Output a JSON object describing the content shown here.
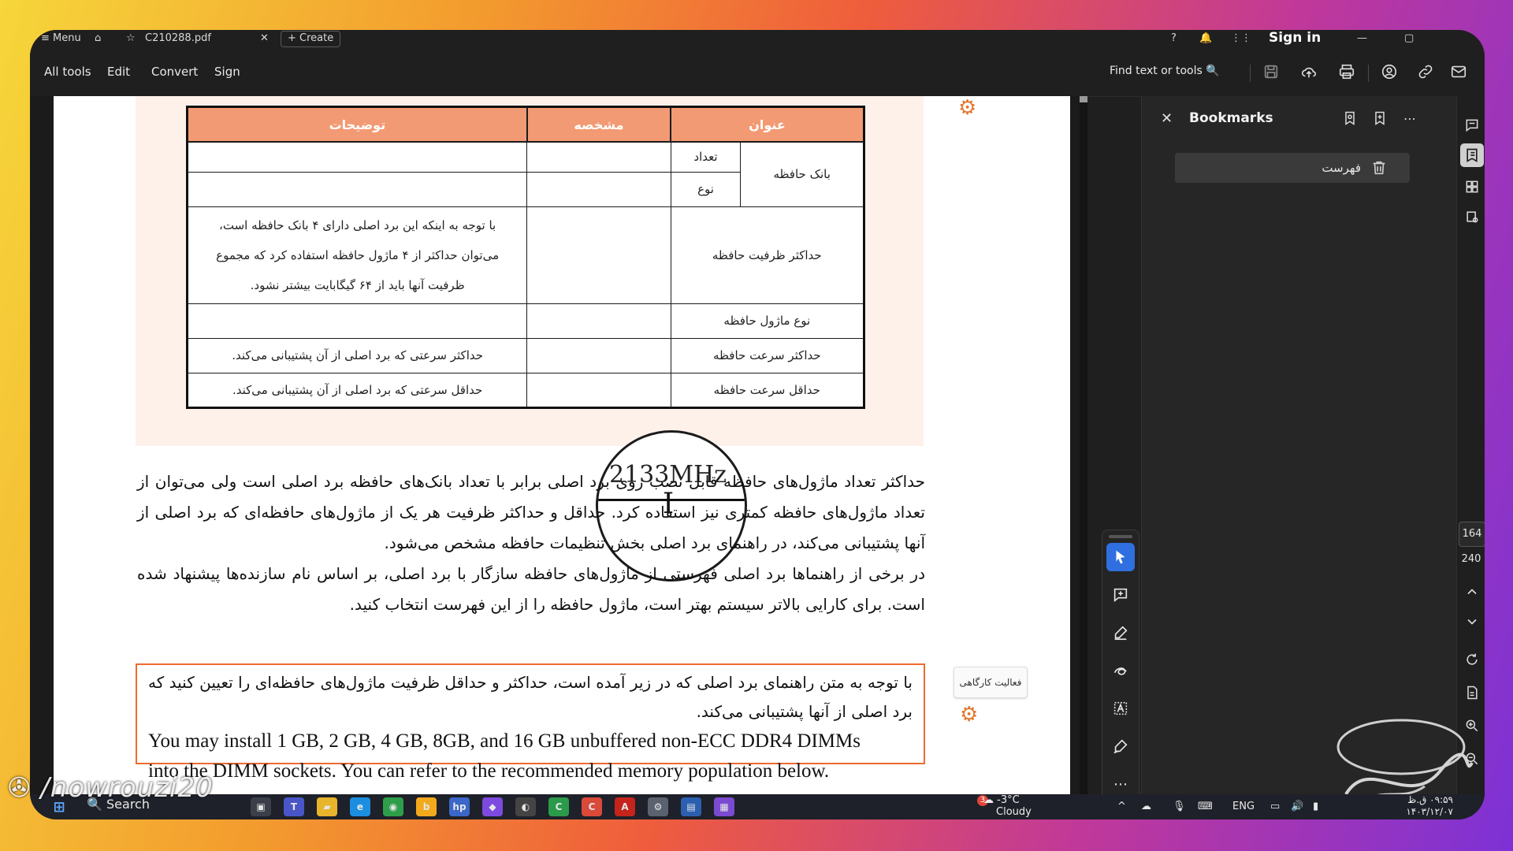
{
  "titlebar": {
    "menu_label": "Menu",
    "tab_name": "C210288.pdf",
    "create_label": "Create",
    "sign_in": "Sign in"
  },
  "toolbar": {
    "all_tools": "All tools",
    "edit": "Edit",
    "convert": "Convert",
    "sign": "Sign",
    "find_placeholder": "Find text or tools"
  },
  "table": {
    "headers": [
      "عنوان",
      "مشخصه",
      "توضیحات"
    ],
    "rows": {
      "memory_bank": "بانک حافظه",
      "count": "تعداد",
      "type": "نوع",
      "max_capacity": "حداکثر ظرفیت حافظه",
      "max_capacity_desc_1": "با توجه به اینکه این برد اصلی دارای ۴ بانک حافظه است،",
      "max_capacity_desc_2": "می‌توان حداکثر از ۴ ماژول حافظه استفاده کرد که مجموع",
      "max_capacity_desc_3": "ظرفیت آنها باید از ۶۴ گیگابایت بیشتر نشود.",
      "module_type": "نوع ماژول حافظه",
      "max_speed": "حداکثر سرعت حافظه",
      "max_speed_desc": "حداکثر سرعتی که برد اصلی از آن پشتیبانی می‌کند.",
      "min_speed": "حداقل سرعت حافظه",
      "min_speed_desc": "حداقل سرعتی که برد اصلی از آن پشتیبانی می‌کند."
    }
  },
  "magnifier_text": "2133MHz",
  "paragraphs": {
    "p1": "حداکثر تعداد ماژول‌های حافظه قابل نصب روی برد اصلی برابر با تعداد بانک‌های حافظه برد اصلی است ولی می‌توان از تعداد ماژول‌های حافظه کمتری نیز استفاده کرد. حداقل و حداکثر ظرفیت هر یک از ماژول‌های حافظه‌ای که برد اصلی از آنها پشتیبانی می‌کند، در راهنمای برد اصلی بخش تنظیمات حافظه مشخص می‌شود.",
    "p2": "در برخی از راهنماها برد اصلی فهرستی از ماژول‌های حافظه سازگار با برد اصلی، بر اساس نام سازنده‌ها پیشنهاد شده است. برای کارایی بالاتر سیستم بهتر است، ماژول حافظه را از این فهرست انتخاب کنید."
  },
  "activity": {
    "side_label": "فعالیت کارگاهی",
    "fa_text": "با توجه به متن راهنمای برد اصلی که در زیر آمده است، حداکثر و حداقل ظرفیت ماژول‌های حافظه‌ای را تعیین کنید که برد اصلی از آنها پشتیبانی می‌کند.",
    "en_line1": "You may install 1 GB, 2 GB, 4 GB, 8GB, and 16 GB unbuffered non-ECC DDR4 DIMMs",
    "en_line2": "into the DIMM sockets. You can refer to the recommended memory population below."
  },
  "bookmarks": {
    "title": "Bookmarks",
    "items": [
      "فهرست"
    ]
  },
  "pages": {
    "current": "164",
    "total": "240"
  },
  "taskbar": {
    "search": "Search",
    "weather_temp": "-3°C",
    "weather_desc": "Cloudy",
    "weather_badge": "3",
    "lang": "ENG",
    "time": "۰۹:۵۹ ق.ظ",
    "date": "۱۴۰۳/۱۲/۰۷"
  },
  "watermark": "/nowrouzi20",
  "colors": {
    "table_header": "#f29a73",
    "activity_border": "#ee6b2e",
    "active_tool": "#2f6fe0",
    "peach_bg": "#fdf1ea"
  }
}
